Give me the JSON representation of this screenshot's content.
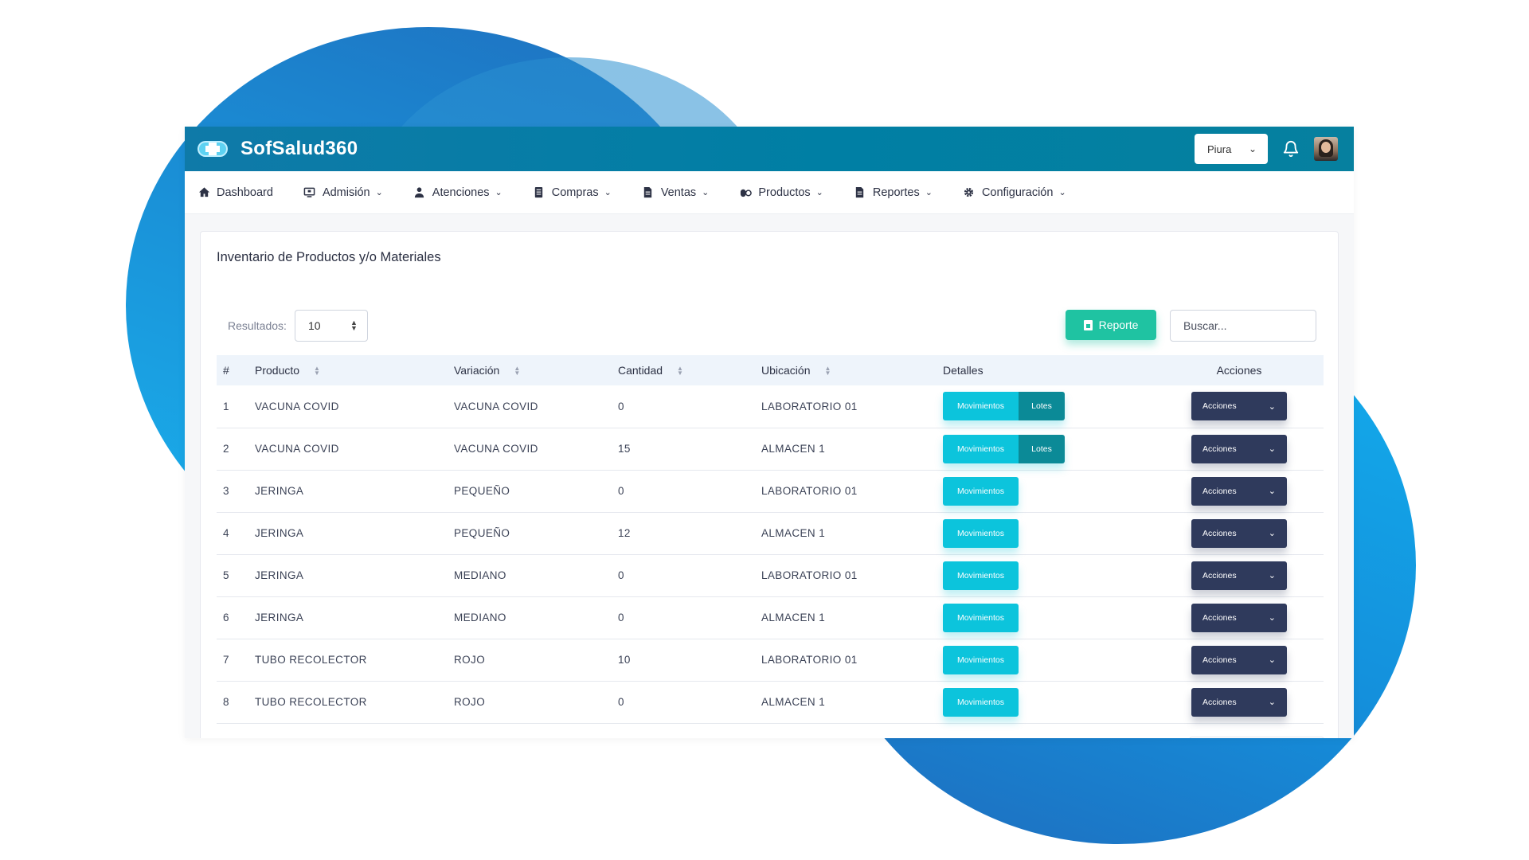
{
  "app": {
    "brand": "SofSalud360",
    "city": "Piura",
    "icons": {
      "logo": "medical-cross-pill-icon",
      "bell": "bell-icon",
      "avatar": "user-avatar"
    }
  },
  "nav": {
    "items": [
      {
        "label": "Dashboard",
        "icon": "home-icon",
        "dropdown": false
      },
      {
        "label": "Admisión",
        "icon": "monitor-icon",
        "dropdown": true
      },
      {
        "label": "Atenciones",
        "icon": "user-icon",
        "dropdown": true
      },
      {
        "label": "Compras",
        "icon": "document-list-icon",
        "dropdown": true
      },
      {
        "label": "Ventas",
        "icon": "file-icon",
        "dropdown": true
      },
      {
        "label": "Productos",
        "icon": "pills-icon",
        "dropdown": true
      },
      {
        "label": "Reportes",
        "icon": "file-icon",
        "dropdown": true
      },
      {
        "label": "Configuración",
        "icon": "gear-icon",
        "dropdown": true
      }
    ]
  },
  "card": {
    "title": "Inventario de Productos y/o Materiales",
    "results_label": "Resultados:",
    "results_value": "10",
    "report_label": "Reporte",
    "search_placeholder": "Buscar..."
  },
  "table": {
    "headers": {
      "num": "#",
      "producto": "Producto",
      "variacion": "Variación",
      "cantidad": "Cantidad",
      "ubicacion": "Ubicación",
      "detalles": "Detalles",
      "acciones": "Acciones"
    },
    "buttons": {
      "movimientos": "Movimientos",
      "lotes": "Lotes",
      "acciones": "Acciones"
    },
    "rows": [
      {
        "num": "1",
        "producto": "VACUNA COVID",
        "variacion": "VACUNA COVID",
        "cantidad": "0",
        "ubicacion": "LABORATORIO 01",
        "lotes": true
      },
      {
        "num": "2",
        "producto": "VACUNA COVID",
        "variacion": "VACUNA COVID",
        "cantidad": "15",
        "ubicacion": "ALMACEN 1",
        "lotes": true
      },
      {
        "num": "3",
        "producto": "JERINGA",
        "variacion": "PEQUEÑO",
        "cantidad": "0",
        "ubicacion": "LABORATORIO 01",
        "lotes": false
      },
      {
        "num": "4",
        "producto": "JERINGA",
        "variacion": "PEQUEÑO",
        "cantidad": "12",
        "ubicacion": "ALMACEN 1",
        "lotes": false
      },
      {
        "num": "5",
        "producto": "JERINGA",
        "variacion": "MEDIANO",
        "cantidad": "0",
        "ubicacion": "LABORATORIO 01",
        "lotes": false
      },
      {
        "num": "6",
        "producto": "JERINGA",
        "variacion": "MEDIANO",
        "cantidad": "0",
        "ubicacion": "ALMACEN 1",
        "lotes": false
      },
      {
        "num": "7",
        "producto": "TUBO RECOLECTOR",
        "variacion": "ROJO",
        "cantidad": "10",
        "ubicacion": "LABORATORIO 01",
        "lotes": false
      },
      {
        "num": "8",
        "producto": "TUBO RECOLECTOR",
        "variacion": "ROJO",
        "cantidad": "0",
        "ubicacion": "ALMACEN 1",
        "lotes": false
      }
    ]
  },
  "colors": {
    "topbar": "#007fa4",
    "report": "#1fc3a2",
    "movimientos": "#0cc4dc",
    "lotes": "#0b8a97",
    "acciones": "#2f3a5c",
    "background_blob": "#1a8fd6"
  }
}
